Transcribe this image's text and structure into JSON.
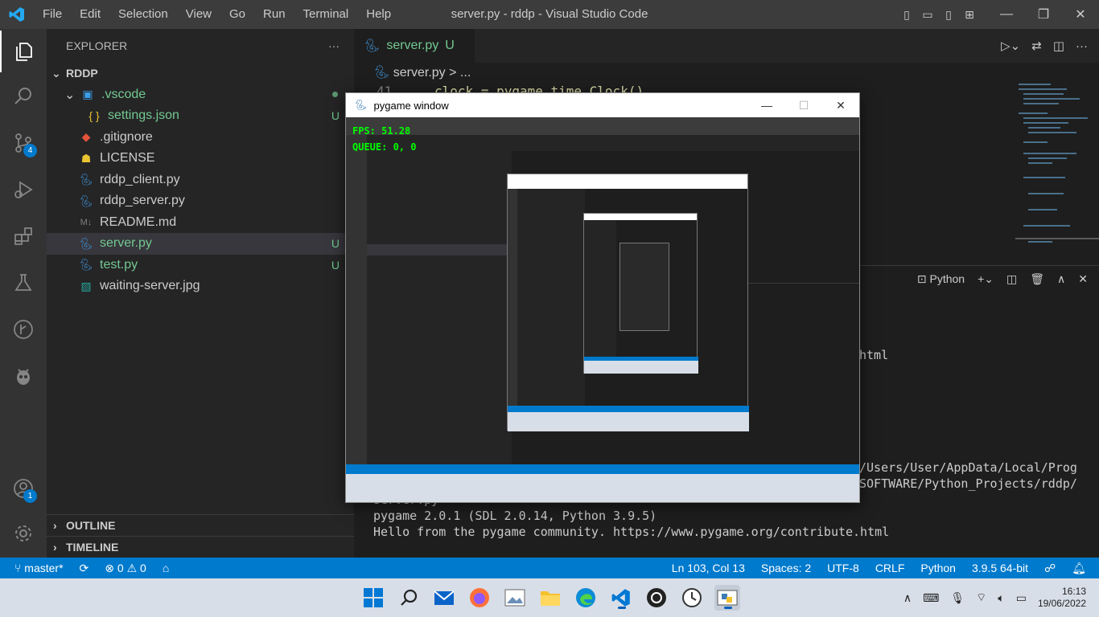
{
  "window": {
    "title": "server.py - rddp - Visual Studio Code",
    "menu": [
      "File",
      "Edit",
      "Selection",
      "View",
      "Go",
      "Run",
      "Terminal",
      "Help"
    ]
  },
  "activity": {
    "scm_badge": "4",
    "accounts_badge": "1"
  },
  "explorer": {
    "header": "EXPLORER",
    "more": "···",
    "project": "RDDP",
    "items": [
      {
        "name": ".vscode",
        "kind": "folder",
        "git": ""
      },
      {
        "name": "settings.json",
        "kind": "json",
        "git": "U"
      },
      {
        "name": ".gitignore",
        "kind": "git",
        "git": ""
      },
      {
        "name": "LICENSE",
        "kind": "license",
        "git": ""
      },
      {
        "name": "rddp_client.py",
        "kind": "python",
        "git": ""
      },
      {
        "name": "rddp_server.py",
        "kind": "python",
        "git": ""
      },
      {
        "name": "README.md",
        "kind": "markdown",
        "git": ""
      },
      {
        "name": "server.py",
        "kind": "python",
        "git": "U"
      },
      {
        "name": "test.py",
        "kind": "python",
        "git": "U"
      },
      {
        "name": "waiting-server.jpg",
        "kind": "image",
        "git": ""
      }
    ],
    "outline": "OUTLINE",
    "timeline": "TIMELINE"
  },
  "editor": {
    "tab_label": "server.py",
    "tab_status": "U",
    "breadcrumb_file": "server.py",
    "breadcrumb_rest": "> ...",
    "line_number": "41",
    "line_code": "clock = pygame.time.Clock()"
  },
  "panel": {
    "terminal_name": "Python",
    "lines": [
      "html",
      "/Users/User/AppData/Local/Prog",
      "SOFTWARE/Python_Projects/rddp/",
      "server.py",
      "pygame 2.0.1 (SDL 2.0.14, Python 3.9.5)",
      "Hello from the pygame community. https://www.pygame.org/contribute.html"
    ]
  },
  "pygame": {
    "title": "pygame window",
    "fps": "FPS: 51.28",
    "queue": "QUEUE: 0, 0"
  },
  "status": {
    "branch": "master*",
    "errors": "0",
    "warnings": "0",
    "position": "Ln 103, Col 13",
    "spaces": "Spaces: 2",
    "encoding": "UTF-8",
    "eol": "CRLF",
    "language": "Python",
    "interpreter": "3.9.5 64-bit"
  },
  "taskbar": {
    "time": "16:13",
    "date": "19/06/2022"
  },
  "colors": {
    "accent": "#007acc",
    "git_untracked": "#73c991",
    "fps_text": "#00ff00"
  }
}
